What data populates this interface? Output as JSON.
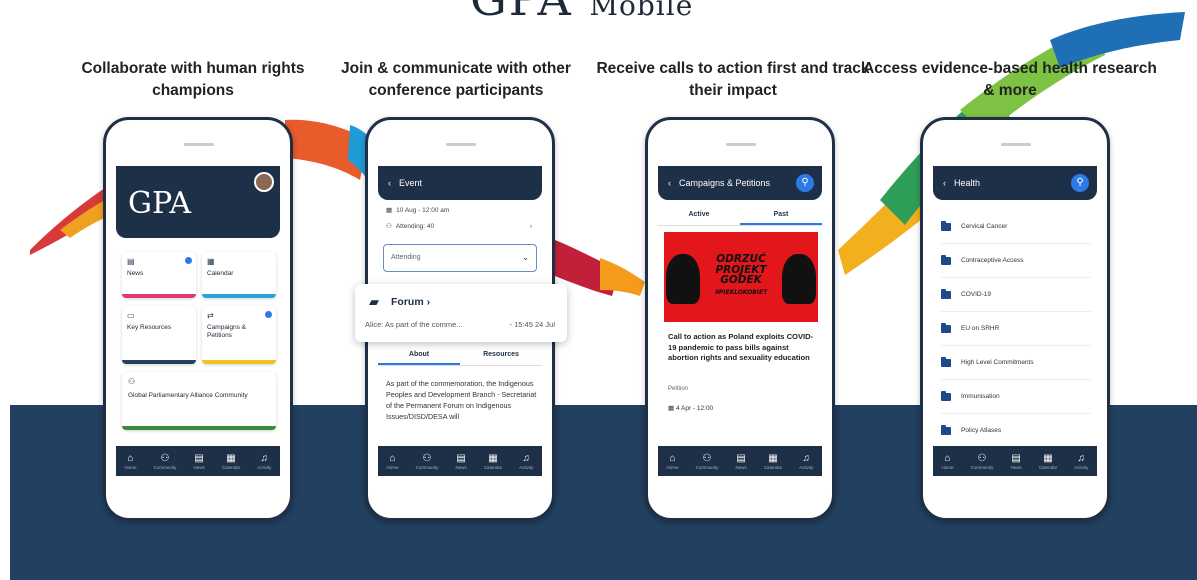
{
  "brand": {
    "letters": "GPA",
    "suffix": "Mobile"
  },
  "captions": [
    "Collaborate with human rights champions",
    "Join & communicate with other conference participants",
    "Receive calls to action first and track their impact",
    "Access evidence-based health research & more"
  ],
  "nav": {
    "home": "Home",
    "community": "Community",
    "news": "News",
    "calendar": "Calendar",
    "activity": "Activity"
  },
  "phone1": {
    "logo": "GPA",
    "tiles": {
      "news": "News",
      "calendar": "Calendar",
      "key_resources": "Key Resources",
      "campaigns": "Campaigns & Petitions"
    },
    "community_label": "Global Parliamentary Alliance Community"
  },
  "phone2": {
    "header": "Event",
    "date": "10 Aug - 12:00 am",
    "attending_count": "Attending: 40",
    "dropdown_value": "Attending",
    "forum_title": "Forum",
    "forum_message": "Alice: As part of the comme...",
    "forum_time": "- 15:45 24 Jul",
    "tab_about": "About",
    "tab_resources": "Resources",
    "description": "As part of the commemoration, the Indigenous Peoples and Development Branch - Secretariat of the Permanent Forum on Indigenous Issues/DISD/DESA will"
  },
  "phone3": {
    "header": "Campaigns & Petitions",
    "tab_active": "Active",
    "tab_past": "Past",
    "poster_slogan": "ODRZUĆ PROJEKT GODEK",
    "poster_tag": "#PIEKLOKOBIET",
    "card_text": "Call to action as Poland exploits COVID-19 pandemic to pass bills against abortion rights and sexuality education",
    "card_type": "Petition",
    "card_date": "4 Apr - 12:00"
  },
  "phone4": {
    "header": "Health",
    "items": [
      "Cervical Cancer",
      "Contraceptive Access",
      "COVID-19",
      "EU on SRHR",
      "High Level Commitments",
      "Immunisation",
      "Policy Atlases"
    ]
  },
  "colors": {
    "navy": "#1e2f48",
    "band": "#22405f",
    "accent_blue": "#2c7be5",
    "poster_red": "#e3161b"
  }
}
